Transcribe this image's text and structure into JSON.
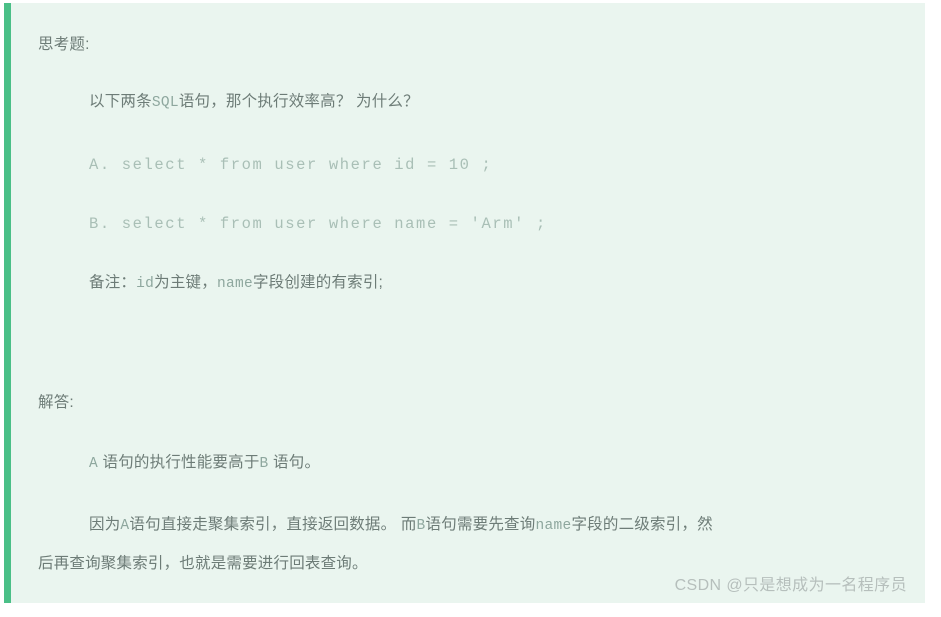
{
  "card": {
    "accent_color": "#4abf87",
    "background_color": "#eaf5ef",
    "text_color": "#6d7c77",
    "code_color": "#a9bfb6"
  },
  "question": {
    "heading": "思考题:",
    "prompt_part1": "以下两条",
    "prompt_code": "SQL",
    "prompt_part2": "语句，那个执行效率高？ 为什么？",
    "option_a": "A. select * from user where id = 10 ;",
    "option_b": "B. select * from user where name = 'Arm' ;",
    "note_label": "备注：",
    "note_code_1": "id",
    "note_text_1": "为主键，",
    "note_code_2": "name",
    "note_text_2": "字段创建的有索引;"
  },
  "answer": {
    "heading": "解答:",
    "summary_code_1": "A",
    "summary_text_1": " 语句的执行性能要高于",
    "summary_code_2": "B",
    "summary_text_2": " 语句。",
    "detail_1_text_1": "因为",
    "detail_1_code_1": "A",
    "detail_1_text_2": "语句直接走聚集索引，直接返回数据。  而",
    "detail_1_code_2": "B",
    "detail_1_text_3": "语句需要先查询",
    "detail_1_code_3": "name",
    "detail_1_text_4": "字段的二级索引，然",
    "detail_2": "后再查询聚集索引，也就是需要进行回表查询。"
  },
  "watermark": {
    "text": "CSDN @只是想成为一名程序员"
  }
}
